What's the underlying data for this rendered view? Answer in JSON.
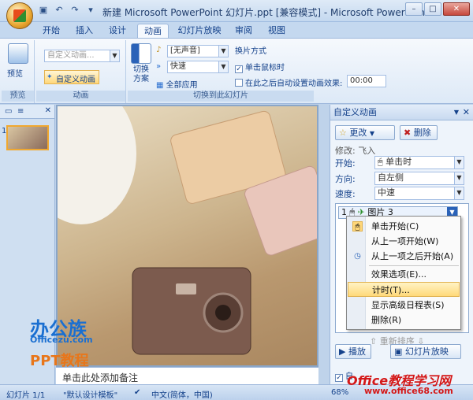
{
  "title": "新建 Microsoft PowerPoint 幻灯片.ppt [兼容模式] - Microsoft PowerPoint",
  "tabs": [
    "开始",
    "插入",
    "设计",
    "动画",
    "幻灯片放映",
    "审阅",
    "视图"
  ],
  "ribbon": {
    "preview": {
      "button": "预览",
      "group": "预览"
    },
    "animation": {
      "combo": "自定义动画...",
      "custom": "自定义动画",
      "group": "动画"
    },
    "transition": {
      "switch_label": "切换\n方案",
      "sound": "[无声音]",
      "speed": "快速",
      "apply_all": "全部应用",
      "advance_title": "换片方式",
      "on_click": "单击鼠标时",
      "auto_after": "在此之后自动设置动画效果:",
      "time": "00:00",
      "group": "切换到此幻灯片"
    }
  },
  "slide_pane": {
    "number": "1"
  },
  "notes": "单击此处添加备注",
  "task_pane": {
    "title": "自定义动画",
    "change": "更改",
    "delete": "删除",
    "modify": "修改: 飞入",
    "start_label": "开始:",
    "start_value": "单击时",
    "direction_label": "方向:",
    "direction_value": "自左侧",
    "speed_label": "速度:",
    "speed_value": "中速",
    "item": "图片 3",
    "item_number": "1",
    "reorder": "重新排序",
    "play": "播放",
    "slideshow": "幻灯片放映",
    "autopreview": "自"
  },
  "context_menu": [
    {
      "label": "单击开始(C)",
      "icon": "mouse-icon"
    },
    {
      "label": "从上一项开始(W)",
      "icon": ""
    },
    {
      "label": "从上一项之后开始(A)",
      "icon": "clock-icon"
    },
    {
      "label": "效果选项(E)...",
      "icon": ""
    },
    {
      "label": "计时(T)...",
      "icon": "",
      "highlight": true
    },
    {
      "label": "显示高级日程表(S)",
      "icon": ""
    },
    {
      "label": "删除(R)",
      "icon": ""
    }
  ],
  "status": {
    "slide": "幻灯片 1/1",
    "theme": "\"默认设计模板\"",
    "language": "中文(简体，中国)",
    "zoom": "68%"
  },
  "watermarks": {
    "w1": "办公族",
    "w2": "Officezu.com",
    "w3": "PPT教程",
    "w4": "Office教程学习网",
    "w5": "www.office68.com"
  }
}
